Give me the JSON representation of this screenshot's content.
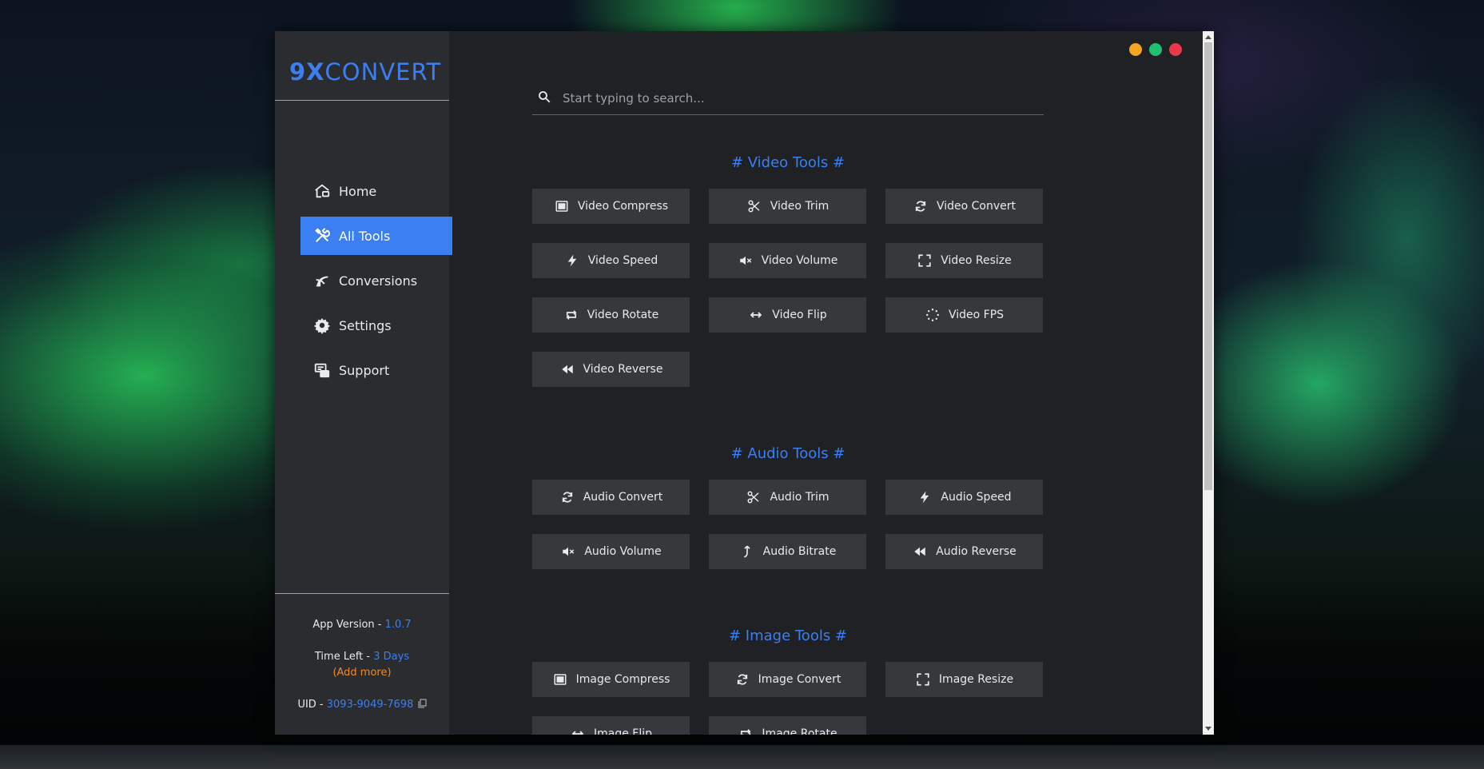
{
  "brand": {
    "logo_nine": "9X",
    "logo_rest": "CONVERT"
  },
  "nav": [
    {
      "label": "Home",
      "icon": "home-icon"
    },
    {
      "label": "All Tools",
      "icon": "tools-icon",
      "active": true
    },
    {
      "label": "Conversions",
      "icon": "conversions-icon"
    },
    {
      "label": "Settings",
      "icon": "gear-icon"
    },
    {
      "label": "Support",
      "icon": "support-icon"
    }
  ],
  "info": {
    "version_label": "App Version - ",
    "version": "1.0.7",
    "time_label": "Time Left - ",
    "time_left": "3 Days",
    "add_more": "(Add more)",
    "uid_label": "UID - ",
    "uid": "3093-9049-7698"
  },
  "window_controls": {
    "colors": [
      "#f5a623",
      "#1fbf73",
      "#e8394a"
    ]
  },
  "search": {
    "placeholder": "Start typing to search..."
  },
  "sections": [
    {
      "title": "# Video Tools #",
      "tools": [
        {
          "label": "Video Compress",
          "icon": "compress-icon"
        },
        {
          "label": "Video Trim",
          "icon": "scissors-icon"
        },
        {
          "label": "Video Convert",
          "icon": "refresh-icon"
        },
        {
          "label": "Video Speed",
          "icon": "bolt-icon"
        },
        {
          "label": "Video Volume",
          "icon": "mute-icon"
        },
        {
          "label": "Video Resize",
          "icon": "resize-icon"
        },
        {
          "label": "Video Rotate",
          "icon": "rotate-icon"
        },
        {
          "label": "Video Flip",
          "icon": "flip-icon"
        },
        {
          "label": "Video FPS",
          "icon": "spinner-icon"
        },
        {
          "label": "Video Reverse",
          "icon": "rewind-icon"
        }
      ]
    },
    {
      "title": "# Audio Tools #",
      "tools": [
        {
          "label": "Audio Convert",
          "icon": "refresh-icon"
        },
        {
          "label": "Audio Trim",
          "icon": "scissors-icon"
        },
        {
          "label": "Audio Speed",
          "icon": "bolt-icon"
        },
        {
          "label": "Audio Volume",
          "icon": "mute-icon"
        },
        {
          "label": "Audio Bitrate",
          "icon": "bitrate-icon"
        },
        {
          "label": "Audio Reverse",
          "icon": "rewind-icon"
        }
      ]
    },
    {
      "title": "# Image Tools #",
      "tools": [
        {
          "label": "Image Compress",
          "icon": "compress-icon"
        },
        {
          "label": "Image Convert",
          "icon": "refresh-icon"
        },
        {
          "label": "Image Resize",
          "icon": "resize-icon"
        },
        {
          "label": "Image Flip",
          "icon": "flip-icon"
        },
        {
          "label": "Image Rotate",
          "icon": "rotate-icon"
        }
      ]
    }
  ],
  "colors": {
    "accent": "#3d7ef0",
    "active_nav": "#3b7ff2",
    "link_orange": "#f0882a"
  }
}
